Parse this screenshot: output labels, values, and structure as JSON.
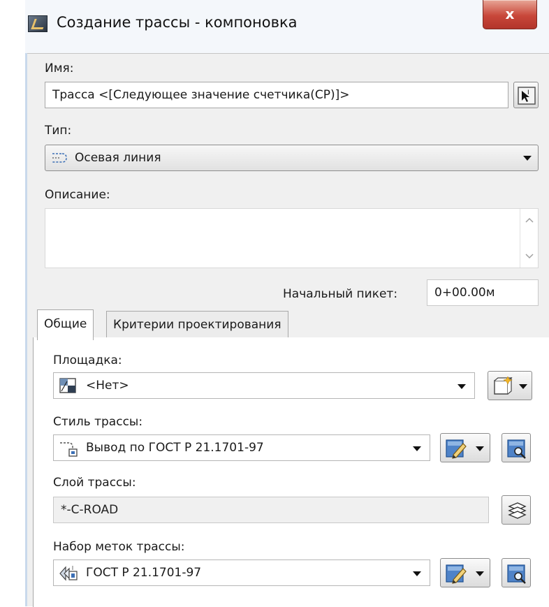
{
  "window": {
    "title": "Создание трассы - компоновка",
    "close_glyph": "x"
  },
  "name": {
    "label": "Имя:",
    "value": "Трасса <[Следующее значение счетчика(CP)]>"
  },
  "type": {
    "label": "Тип:",
    "value": "Осевая линия"
  },
  "description": {
    "label": "Описание:",
    "value": ""
  },
  "start_station": {
    "label": "Начальный пикет:",
    "value": "0+00.00м"
  },
  "tabs": [
    {
      "label": "Общие",
      "active": true
    },
    {
      "label": "Критерии проектирования",
      "active": false
    }
  ],
  "general": {
    "site": {
      "label": "Площадка:",
      "value": "<Нет>"
    },
    "alignment_style": {
      "label": "Стиль трассы:",
      "value": "Вывод по ГОСТ Р 21.1701-97"
    },
    "alignment_layer": {
      "label": "Слой трассы:",
      "value": "*-C-ROAD"
    },
    "label_set": {
      "label": "Набор меток трассы:",
      "value": "ГОСТ Р 21.1701-97"
    }
  },
  "icons": {
    "app": "civil3d-app-icon",
    "name_pick": "text-pick-icon",
    "type": "centerline-icon",
    "site": "site-icon",
    "style": "alignment-style-icon",
    "edit": "edit-style-icon",
    "preview": "preview-icon",
    "layer": "layers-icon",
    "label_set": "label-set-icon",
    "new_site": "new-site-icon"
  },
  "colors": {
    "close_button": "#c8473a",
    "icon_blue": "#3b6fb6"
  }
}
